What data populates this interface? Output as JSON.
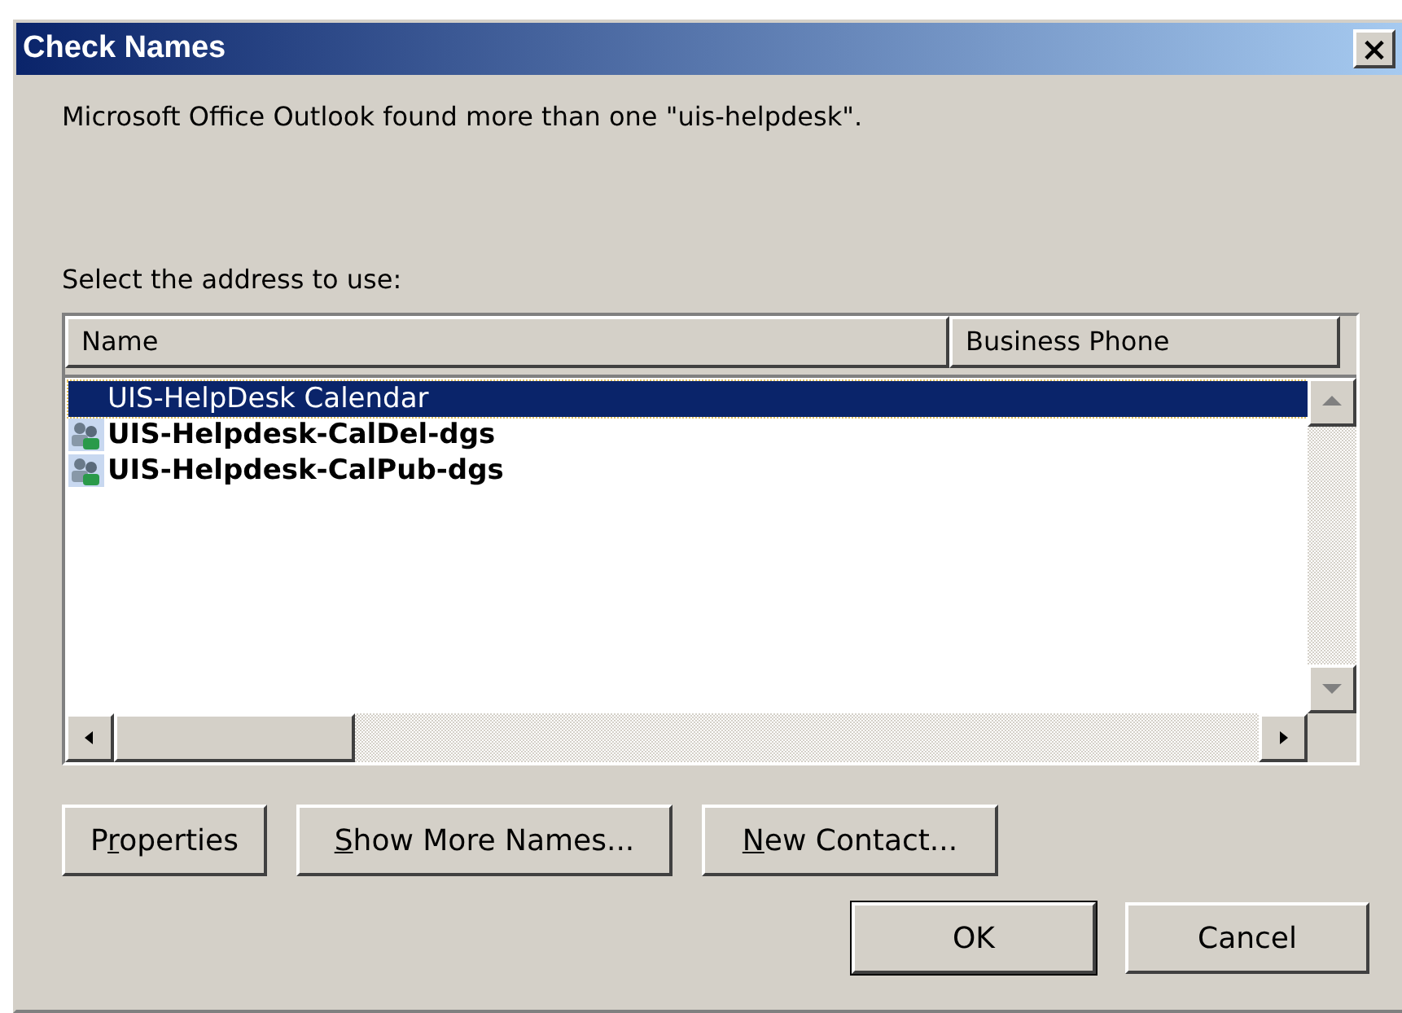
{
  "window": {
    "title": "Check Names",
    "close": "×"
  },
  "message": "Microsoft Office Outlook found more than one \"uis-helpdesk\".",
  "prompt": "Select the address to use:",
  "table": {
    "columns": [
      "Name",
      "Business Phone"
    ],
    "rows": [
      {
        "name": "UIS-HelpDesk Calendar",
        "selected": true,
        "has_icon": false
      },
      {
        "name": "UIS-Helpdesk-CalDel-dgs",
        "selected": false,
        "has_icon": true
      },
      {
        "name": "UIS-Helpdesk-CalPub-dgs",
        "selected": false,
        "has_icon": true
      }
    ]
  },
  "buttons": [
    {
      "before": "P",
      "key": "r",
      "after": "operties",
      "kind": "action"
    },
    {
      "key": "S",
      "after": "how More Names...",
      "kind": "action"
    },
    {
      "key": "N",
      "after": "ew Contact...",
      "kind": "action"
    },
    {
      "before": "OK",
      "kind": "default"
    },
    {
      "before": "Cancel",
      "kind": "normal"
    }
  ]
}
